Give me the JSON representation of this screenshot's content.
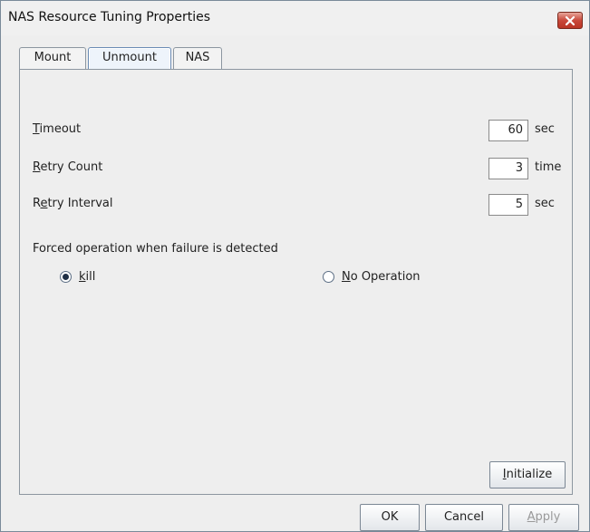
{
  "window": {
    "title": "NAS Resource Tuning Properties"
  },
  "tabs": [
    {
      "label": "Mount",
      "selected": false
    },
    {
      "label": "Unmount",
      "selected": true
    },
    {
      "label": "NAS",
      "selected": false
    }
  ],
  "fields": {
    "timeout": {
      "mnemonic": "T",
      "rest": "imeout",
      "value": "60",
      "unit": "sec"
    },
    "retry_count": {
      "mnemonic": "R",
      "rest": "etry Count",
      "value": "3",
      "unit": "time"
    },
    "retry_interval": {
      "pre": "R",
      "mnemonic": "e",
      "rest": "try Interval",
      "value": "5",
      "unit": "sec"
    }
  },
  "forced_operation": {
    "label": "Forced operation when failure is detected",
    "options": [
      {
        "mnemonic": "k",
        "rest": "ill",
        "selected": true
      },
      {
        "mnemonic": "N",
        "rest": "o Operation",
        "selected": false
      }
    ]
  },
  "buttons": {
    "initialize": {
      "mnemonic": "I",
      "rest": "nitialize"
    },
    "ok": "OK",
    "cancel": "Cancel",
    "apply": {
      "mnemonic": "A",
      "rest": "pply",
      "enabled": false
    }
  },
  "icons": {
    "close": "close-icon"
  },
  "colors": {
    "close_button": "#c9483a",
    "selected_tab": "#eef4fb"
  }
}
